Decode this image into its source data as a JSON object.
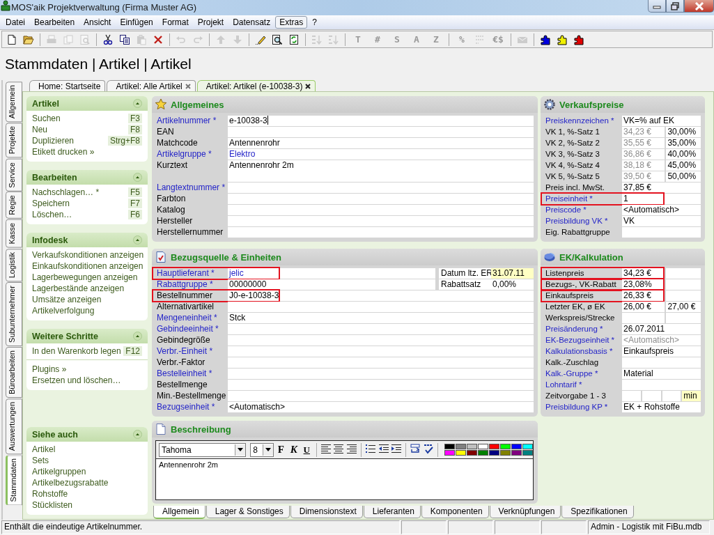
{
  "window": {
    "title": "MOS'aik Projektverwaltung (Firma Muster AG)"
  },
  "menu": [
    {
      "label": "Datei",
      "selected": false
    },
    {
      "label": "Bearbeiten",
      "selected": false
    },
    {
      "label": "Ansicht",
      "selected": false
    },
    {
      "label": "Einfügen",
      "selected": false
    },
    {
      "label": "Format",
      "selected": false
    },
    {
      "label": "Projekt",
      "selected": false
    },
    {
      "label": "Datensatz",
      "selected": false
    },
    {
      "label": "Extras",
      "selected": true
    },
    {
      "label": "?",
      "selected": false
    }
  ],
  "toolbar": [
    {
      "kind": "icon",
      "disabled": false
    },
    {
      "kind": "icon",
      "disabled": false
    },
    {
      "kind": "separator"
    },
    {
      "kind": "icon",
      "disabled": true
    },
    {
      "kind": "icon",
      "disabled": true
    },
    {
      "kind": "icon",
      "disabled": true
    },
    {
      "kind": "separator"
    },
    {
      "kind": "icon",
      "disabled": false
    },
    {
      "kind": "icon",
      "disabled": false
    },
    {
      "kind": "icon",
      "disabled": true
    },
    {
      "kind": "icon",
      "disabled": false
    },
    {
      "kind": "separator"
    },
    {
      "kind": "icon",
      "disabled": true
    },
    {
      "kind": "icon",
      "disabled": true
    },
    {
      "kind": "separator"
    },
    {
      "kind": "icon",
      "disabled": true
    },
    {
      "kind": "icon",
      "disabled": true
    },
    {
      "kind": "separator"
    },
    {
      "kind": "icon",
      "disabled": false
    },
    {
      "kind": "icon",
      "disabled": false
    },
    {
      "kind": "icon",
      "disabled": false
    },
    {
      "kind": "separator"
    },
    {
      "kind": "icon",
      "disabled": true
    },
    {
      "kind": "icon",
      "disabled": true
    },
    {
      "kind": "separator"
    },
    {
      "kind": "glyph",
      "text": "T",
      "disabled": true
    },
    {
      "kind": "glyph",
      "text": "#",
      "disabled": true
    },
    {
      "kind": "glyph",
      "text": "S",
      "disabled": true
    },
    {
      "kind": "glyph",
      "text": "A",
      "disabled": true
    },
    {
      "kind": "glyph",
      "text": "Z",
      "disabled": true
    },
    {
      "kind": "separator"
    },
    {
      "kind": "glyph",
      "text": "%",
      "disabled": true
    },
    {
      "kind": "icon",
      "disabled": true
    },
    {
      "kind": "glyph",
      "text": "€$",
      "disabled": true
    },
    {
      "kind": "separator"
    },
    {
      "kind": "icon",
      "disabled": true
    },
    {
      "kind": "separator"
    },
    {
      "kind": "plugin",
      "color": "#0000e0"
    },
    {
      "kind": "plugin",
      "color": "#f0f000"
    },
    {
      "kind": "plugin",
      "color": "#e00000"
    }
  ],
  "heading": "Stammdaten | Artikel | Artikel",
  "side_tabs": [
    {
      "label": "Allgemein",
      "selected": false
    },
    {
      "label": "Projekte",
      "selected": false
    },
    {
      "label": "Service",
      "selected": false
    },
    {
      "label": "Regie",
      "selected": false
    },
    {
      "label": "Kasse",
      "selected": false
    },
    {
      "label": "Logistik",
      "selected": false
    },
    {
      "label": "Subunternehmer",
      "selected": false
    },
    {
      "label": "Büroarbeiten",
      "selected": false
    },
    {
      "label": "Auswertungen",
      "selected": false
    },
    {
      "label": "Stammdaten",
      "selected": true
    }
  ],
  "doc_tabs": [
    {
      "label": "Home: Startseite",
      "selected": false,
      "closable": false
    },
    {
      "label": "Artikel: Alle Artikel",
      "selected": false,
      "closable": true
    },
    {
      "label": "Artikel: Artikel (e-10038-3)",
      "selected": true,
      "closable": true
    }
  ],
  "task_pane": [
    {
      "title": "Artikel",
      "groups": [
        [
          {
            "label": "Suchen",
            "shortcut": "F3"
          },
          {
            "label": "Neu",
            "shortcut": "F8"
          },
          {
            "label": "Duplizieren",
            "shortcut": "Strg+F8"
          },
          {
            "label": "Etikett drucken »"
          }
        ]
      ]
    },
    {
      "title": "Bearbeiten",
      "groups": [
        [
          {
            "label": "Nachschlagen… *",
            "shortcut": "F5"
          },
          {
            "label": "Speichern",
            "shortcut": "F7"
          },
          {
            "label": "Löschen…",
            "shortcut": "F6"
          }
        ]
      ]
    },
    {
      "title": "Infodesk",
      "groups": [
        [
          {
            "label": "Verkaufskonditionen anzeigen"
          },
          {
            "label": "Einkaufskonditionen anzeigen"
          },
          {
            "label": "Lagerbewegungen anzeigen"
          },
          {
            "label": "Lagerbestände anzeigen"
          },
          {
            "label": "Umsätze anzeigen"
          },
          {
            "label": "Artikelverfolgung"
          }
        ]
      ]
    },
    {
      "title": "Weitere Schritte",
      "groups": [
        [
          {
            "label": "In den Warenkorb legen",
            "shortcut": "F12"
          }
        ],
        [
          {
            "label": "Plugins »"
          },
          {
            "label": "Ersetzen und löschen…"
          }
        ]
      ]
    },
    {
      "title": "Siehe auch",
      "groups": [
        [
          {
            "label": "Artikel"
          },
          {
            "label": "Sets"
          },
          {
            "label": "Artikelgruppen"
          },
          {
            "label": "Artikelbezugsrabatte"
          },
          {
            "label": "Rohstoffe"
          },
          {
            "label": "Stücklisten"
          }
        ]
      ]
    }
  ],
  "allgemeines": {
    "title": "Allgemeines",
    "fields": [
      {
        "label": "Artikelnummer *",
        "link": true,
        "kind": "line",
        "focused": true,
        "highlighted": false,
        "values": [
          {
            "text": "e-10038-3",
            "kind": "plain"
          }
        ]
      },
      {
        "label": "EAN",
        "link": false,
        "kind": "line",
        "focused": false,
        "highlighted": false,
        "values": [
          {
            "kind": "blank"
          }
        ]
      },
      {
        "label": "Matchcode",
        "link": false,
        "kind": "line",
        "focused": false,
        "highlighted": false,
        "values": [
          {
            "text": "Antennenrohr",
            "kind": "plain"
          }
        ]
      },
      {
        "label": "Artikelgruppe *",
        "link": true,
        "kind": "line",
        "focused": false,
        "highlighted": false,
        "values": [
          {
            "text": "Elektro",
            "kind": "link"
          }
        ]
      },
      {
        "label": "Kurztext",
        "link": false,
        "kind": "tall",
        "focused": false,
        "highlighted": false,
        "values": [
          {
            "text": "Antennenrohr 2m",
            "kind": "plain"
          }
        ]
      },
      {
        "label": "Langtextnummer *",
        "link": true,
        "kind": "line",
        "focused": false,
        "highlighted": false,
        "values": [
          {
            "kind": "blank"
          }
        ]
      },
      {
        "label": "Farbton",
        "link": false,
        "kind": "line",
        "focused": false,
        "highlighted": false,
        "values": [
          {
            "kind": "blank"
          }
        ]
      },
      {
        "label": "Katalog",
        "link": false,
        "kind": "line",
        "focused": false,
        "highlighted": false,
        "values": [
          {
            "kind": "blank"
          }
        ]
      },
      {
        "label": "Hersteller",
        "link": false,
        "kind": "line",
        "focused": false,
        "highlighted": false,
        "values": [
          {
            "kind": "blank"
          }
        ]
      },
      {
        "label": "Herstellernummer",
        "link": false,
        "kind": "line",
        "focused": false,
        "highlighted": false,
        "values": [
          {
            "kind": "blank"
          }
        ]
      }
    ]
  },
  "bezugsquelle": {
    "title": "Bezugsquelle & Einheiten",
    "fields": [
      {
        "label": "Hauptlieferant *",
        "link": true,
        "highlighted": true,
        "values": [
          {
            "text": "jelic",
            "kind": "link"
          }
        ],
        "side": {
          "label": "Datum ltz. ER",
          "value": {
            "text": "31.07.11",
            "kind": "note"
          }
        }
      },
      {
        "label": "Rabattgruppe *",
        "link": true,
        "highlighted": false,
        "values": [
          {
            "text": "00000000",
            "kind": "plain"
          }
        ],
        "side": {
          "label": "Rabattsatz",
          "value": {
            "text": "0,00%",
            "kind": "plain"
          }
        }
      },
      {
        "label": "Bestellnummer",
        "link": false,
        "highlighted": true,
        "values": [
          {
            "text": "J0-e-10038-3",
            "kind": "plain"
          }
        ]
      },
      {
        "label": "Alternativartikel",
        "link": false,
        "highlighted": false,
        "values": [
          {
            "kind": "blank"
          }
        ]
      },
      {
        "label": "Mengeneinheit *",
        "link": true,
        "highlighted": false,
        "values": [
          {
            "text": "Stck",
            "kind": "plain"
          }
        ]
      },
      {
        "label": "Gebindeeinheit *",
        "link": true,
        "highlighted": false,
        "values": [
          {
            "kind": "blank"
          }
        ]
      },
      {
        "label": "Gebindegröße",
        "link": false,
        "highlighted": false,
        "values": [
          {
            "kind": "blank"
          }
        ]
      },
      {
        "label": "Verbr.-Einheit *",
        "link": true,
        "highlighted": false,
        "values": [
          {
            "kind": "blank"
          }
        ]
      },
      {
        "label": "Verbr.-Faktor",
        "link": false,
        "highlighted": false,
        "values": [
          {
            "kind": "blank"
          }
        ]
      },
      {
        "label": "Bestelleinheit *",
        "link": true,
        "highlighted": false,
        "values": [
          {
            "kind": "blank"
          }
        ]
      },
      {
        "label": "Bestellmenge",
        "link": false,
        "highlighted": false,
        "values": [
          {
            "kind": "blank"
          }
        ]
      },
      {
        "label": "Min.-Bestellmenge",
        "link": false,
        "highlighted": false,
        "values": [
          {
            "kind": "blank"
          }
        ]
      },
      {
        "label": "Bezugseinheit *",
        "link": true,
        "highlighted": false,
        "values": [
          {
            "text": "<Automatisch>",
            "kind": "plain"
          }
        ]
      }
    ]
  },
  "beschreibung": {
    "title": "Beschreibung",
    "font": "Tahoma",
    "size": "8",
    "format_buttons": [
      {
        "label": "F",
        "kind": "bold"
      },
      {
        "label": "K",
        "kind": "italic"
      },
      {
        "label": "U",
        "kind": "underline"
      }
    ],
    "palette": [
      {
        "color": "#000000"
      },
      {
        "color": "#808080"
      },
      {
        "color": "#c0c0c0"
      },
      {
        "color": "#ffffff"
      },
      {
        "color": "#ff0000"
      },
      {
        "color": "#00ff00"
      },
      {
        "color": "#0000ff"
      },
      {
        "color": "#00ffff"
      },
      {
        "color": "#ff00ff"
      },
      {
        "color": "#ffff00"
      },
      {
        "color": "#800000"
      },
      {
        "color": "#008000"
      },
      {
        "color": "#000080"
      },
      {
        "color": "#808000"
      },
      {
        "color": "#800080"
      },
      {
        "color": "#008080"
      }
    ],
    "text": "Antennenrohr 2m"
  },
  "verkaufspreise": {
    "title": "Verkaufspreise",
    "fields": [
      {
        "label": "Preiskennzeichen *",
        "link": true,
        "highlighted": false,
        "values": [
          {
            "text": "VK=% auf EK",
            "kind": "plain"
          }
        ]
      },
      {
        "label": "VK 1, %-Satz 1",
        "link": false,
        "highlighted": false,
        "values": [
          {
            "text": "34,23 €",
            "kind": "muted"
          },
          {
            "text": "30,00%",
            "kind": "plain"
          }
        ]
      },
      {
        "label": "VK 2, %-Satz 2",
        "link": false,
        "highlighted": false,
        "values": [
          {
            "text": "35,55 €",
            "kind": "muted"
          },
          {
            "text": "35,00%",
            "kind": "plain"
          }
        ]
      },
      {
        "label": "VK 3, %-Satz 3",
        "link": false,
        "highlighted": false,
        "values": [
          {
            "text": "36,86 €",
            "kind": "muted"
          },
          {
            "text": "40,00%",
            "kind": "plain"
          }
        ]
      },
      {
        "label": "VK 4, %-Satz 4",
        "link": false,
        "highlighted": false,
        "values": [
          {
            "text": "38,18 €",
            "kind": "muted"
          },
          {
            "text": "45,00%",
            "kind": "plain"
          }
        ]
      },
      {
        "label": "VK 5, %-Satz 5",
        "link": false,
        "highlighted": false,
        "values": [
          {
            "text": "39,50 €",
            "kind": "muted"
          },
          {
            "text": "50,00%",
            "kind": "plain"
          }
        ]
      },
      {
        "label": "Preis incl. MwSt.",
        "link": false,
        "highlighted": false,
        "values": [
          {
            "text": "37,85 €",
            "kind": "plain"
          }
        ]
      },
      {
        "label": "Preiseinheit *",
        "link": true,
        "highlighted": true,
        "values": [
          {
            "text": "1",
            "kind": "plain"
          }
        ]
      },
      {
        "label": "Preiscode *",
        "link": true,
        "highlighted": false,
        "values": [
          {
            "text": "<Automatisch>",
            "kind": "plain"
          }
        ]
      },
      {
        "label": "Preisbildung VK *",
        "link": true,
        "highlighted": false,
        "values": [
          {
            "text": "VK",
            "kind": "plain"
          }
        ]
      },
      {
        "label": "Eig. Rabattgruppe",
        "link": false,
        "highlighted": false,
        "values": [
          {
            "kind": "blank"
          }
        ]
      }
    ]
  },
  "kalkulation": {
    "title": "EK/Kalkulation",
    "fields": [
      {
        "label": "Listenpreis",
        "link": false,
        "highlighted": true,
        "values": [
          {
            "text": "34,23 €",
            "kind": "plain"
          },
          {
            "kind": "blank"
          }
        ]
      },
      {
        "label": "Bezugs-, VK-Rabatt",
        "link": false,
        "highlighted": true,
        "values": [
          {
            "text": "23,08%",
            "kind": "plain"
          },
          {
            "kind": "blank"
          }
        ]
      },
      {
        "label": "Einkaufspreis",
        "link": false,
        "highlighted": true,
        "values": [
          {
            "text": "26,33 €",
            "kind": "plain"
          },
          {
            "kind": "blank"
          }
        ]
      },
      {
        "label": "Letzter EK, ø EK",
        "link": false,
        "highlighted": false,
        "values": [
          {
            "text": "26,00 €",
            "kind": "plain"
          },
          {
            "text": "27,00 €",
            "kind": "plain"
          }
        ]
      },
      {
        "label": "Werkspreis/Strecke",
        "link": false,
        "highlighted": false,
        "values": [
          {
            "kind": "blank"
          },
          {
            "kind": "blank"
          }
        ]
      },
      {
        "label": "Preisänderung *",
        "link": true,
        "highlighted": false,
        "values": [
          {
            "text": "26.07.2011",
            "kind": "plain"
          }
        ]
      },
      {
        "label": "EK-Bezugseinheit *",
        "link": true,
        "highlighted": false,
        "values": [
          {
            "text": "<Automatisch>",
            "kind": "muted"
          }
        ]
      },
      {
        "label": "Kalkulationsbasis *",
        "link": true,
        "highlighted": false,
        "values": [
          {
            "text": "Einkaufspreis",
            "kind": "plain"
          }
        ]
      },
      {
        "label": "Kalk.-Zuschlag",
        "link": false,
        "highlighted": false,
        "values": [
          {
            "kind": "blank"
          }
        ]
      },
      {
        "label": "Kalk.-Gruppe *",
        "link": true,
        "highlighted": false,
        "values": [
          {
            "text": "Material",
            "kind": "plain"
          }
        ]
      },
      {
        "label": "Lohntarif *",
        "link": true,
        "highlighted": false,
        "values": [
          {
            "kind": "blank"
          }
        ]
      },
      {
        "label": "Zeitvorgabe 1 - 3",
        "link": false,
        "highlighted": false,
        "values": [
          {
            "kind": "blank"
          },
          {
            "kind": "blank"
          },
          {
            "kind": "blank"
          },
          {
            "text": "min",
            "kind": "note"
          }
        ]
      },
      {
        "label": "Preisbildung KP *",
        "link": true,
        "highlighted": false,
        "values": [
          {
            "text": "EK + Rohstoffe",
            "kind": "plain"
          }
        ]
      }
    ]
  },
  "bottom_tabs": [
    {
      "label": "Allgemein",
      "selected": true
    },
    {
      "label": "Lager & Sonstiges",
      "selected": false
    },
    {
      "label": "Dimensionstext",
      "selected": false
    },
    {
      "label": "Lieferanten",
      "selected": false
    },
    {
      "label": "Komponenten",
      "selected": false
    },
    {
      "label": "Verknüpfungen",
      "selected": false
    },
    {
      "label": "Spezifikationen",
      "selected": false
    }
  ],
  "status_bar": {
    "message": "Enthält die eindeutige Artikelnummer.",
    "info": "Admin - Logistik mit FiBu.mdb"
  }
}
